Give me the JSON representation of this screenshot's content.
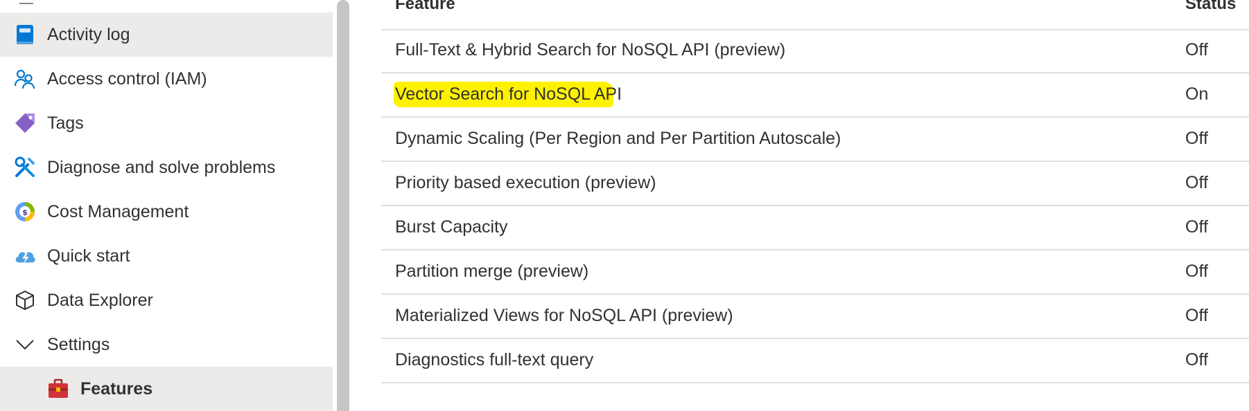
{
  "sidebar": {
    "items": [
      {
        "label": "Activity log",
        "icon": "activity-log-icon",
        "selected": true
      },
      {
        "label": "Access control (IAM)",
        "icon": "people-icon"
      },
      {
        "label": "Tags",
        "icon": "tag-icon"
      },
      {
        "label": "Diagnose and solve problems",
        "icon": "wrench-icon"
      },
      {
        "label": "Cost Management",
        "icon": "cost-management-icon"
      },
      {
        "label": "Quick start",
        "icon": "cloud-lightning-icon"
      },
      {
        "label": "Data Explorer",
        "icon": "cube-icon"
      },
      {
        "label": "Settings",
        "icon": "chevron-down-icon",
        "expanded": true
      },
      {
        "label": "Features",
        "icon": "toolbox-icon",
        "selected": true
      }
    ]
  },
  "table": {
    "headers": {
      "feature": "Feature",
      "status": "Status"
    },
    "rows": [
      {
        "feature": "Full-Text & Hybrid Search for NoSQL API (preview)",
        "status": "Off"
      },
      {
        "feature": "Vector Search for NoSQL API",
        "status": "On",
        "highlighted": true
      },
      {
        "feature": "Dynamic Scaling (Per Region and Per Partition Autoscale)",
        "status": "Off"
      },
      {
        "feature": "Priority based execution (preview)",
        "status": "Off"
      },
      {
        "feature": "Burst Capacity",
        "status": "Off"
      },
      {
        "feature": "Partition merge (preview)",
        "status": "Off"
      },
      {
        "feature": "Materialized Views for NoSQL API (preview)",
        "status": "Off"
      },
      {
        "feature": "Diagnostics full-text query",
        "status": "Off"
      }
    ]
  },
  "colors": {
    "highlight": "#fff200",
    "selected_bg": "#edebe9",
    "accent": "#0078d4"
  }
}
